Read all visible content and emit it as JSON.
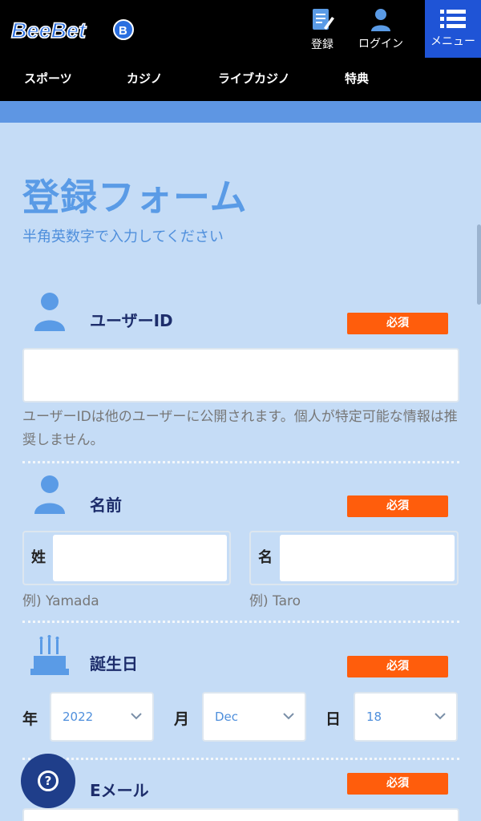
{
  "header": {
    "register_label": "登録",
    "login_label": "ログイン",
    "menu_label": "メニュー"
  },
  "nav": [
    {
      "label": "スポーツ"
    },
    {
      "label": "カジノ"
    },
    {
      "label": "ライブカジノ"
    },
    {
      "label": "特典"
    }
  ],
  "form": {
    "title": "登録フォーム",
    "subtitle": "半角英数字で入力してください",
    "required_label": "必須",
    "user_id": {
      "label": "ユーザーID",
      "value": "",
      "help": "ユーザーIDは他のユーザーに公開されます。個人が特定可能な情報は推奨しません。"
    },
    "name": {
      "label": "名前",
      "last_prefix": "姓",
      "first_prefix": "名",
      "last_example": "例) Yamada",
      "first_example": "例) Taro"
    },
    "dob": {
      "label": "誕生日",
      "year_label": "年",
      "month_label": "月",
      "day_label": "日",
      "year": "2022",
      "month": "Dec",
      "day": "18"
    },
    "email": {
      "label": "Eメール"
    }
  },
  "colors": {
    "header_bg": "#000000",
    "menu_bg": "#1f54d6",
    "page_bg": "#c5dcf6",
    "accent_blue": "#5a9be6",
    "required_badge": "#ff5d0c",
    "help_button": "#1f3e8a"
  }
}
